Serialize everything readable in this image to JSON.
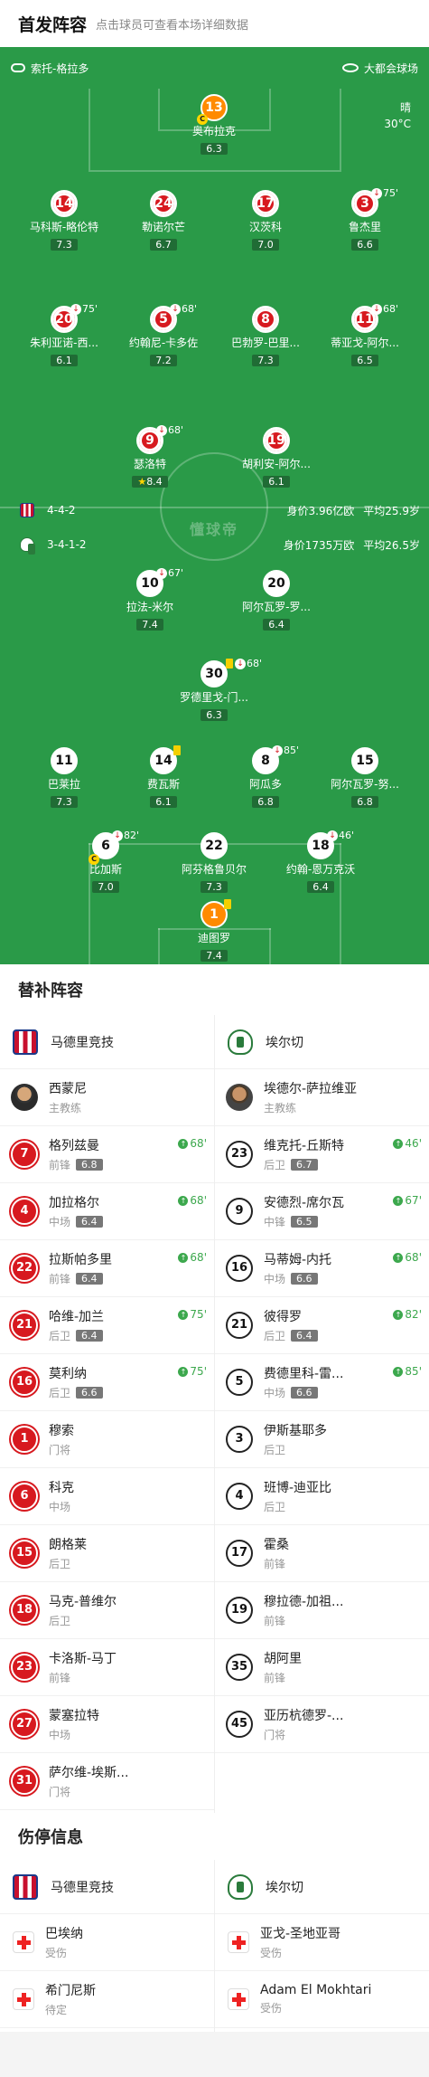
{
  "header": {
    "title": "首发阵容",
    "subtitle": "点击球员可查看本场详细数据"
  },
  "pitch": {
    "referee": "索托-格拉多",
    "stadium": "大都会球场",
    "weather": "晴",
    "temperature": "30°C",
    "watermark": "懂球帝",
    "home_form": {
      "formation": "4-4-2",
      "value": "身价3.96亿欧",
      "age": "平均25.9岁"
    },
    "away_form": {
      "formation": "3-4-1-2",
      "value": "身价1735万欧",
      "age": "平均26.5岁"
    }
  },
  "home_players": [
    {
      "num": "13",
      "name": "奥布拉克",
      "rating": "6.3"
    },
    {
      "num": "14",
      "name": "马科斯-略伦特",
      "rating": "7.3"
    },
    {
      "num": "24",
      "name": "勒诺尔芒",
      "rating": "6.7"
    },
    {
      "num": "17",
      "name": "汉茨科",
      "rating": "7.0"
    },
    {
      "num": "3",
      "name": "鲁杰里",
      "rating": "6.6",
      "sub": "75'"
    },
    {
      "num": "20",
      "name": "朱利亚诺-西...",
      "rating": "6.1",
      "sub": "75'"
    },
    {
      "num": "5",
      "name": "约翰尼-卡多佐",
      "rating": "7.2",
      "sub": "68'"
    },
    {
      "num": "8",
      "name": "巴勃罗-巴里...",
      "rating": "7.3"
    },
    {
      "num": "11",
      "name": "蒂亚戈-阿尔...",
      "rating": "6.5",
      "sub": "68'"
    },
    {
      "num": "9",
      "name": "瑟洛特",
      "rating": "8.4",
      "sub": "68'"
    },
    {
      "num": "19",
      "name": "胡利安-阿尔...",
      "rating": "6.1"
    }
  ],
  "away_players": [
    {
      "num": "10",
      "name": "拉法-米尔",
      "rating": "7.4",
      "sub": "67'"
    },
    {
      "num": "20",
      "name": "阿尔瓦罗-罗...",
      "rating": "6.4"
    },
    {
      "num": "30",
      "name": "罗德里戈-门...",
      "rating": "6.3",
      "sub": "68'"
    },
    {
      "num": "11",
      "name": "巴莱拉",
      "rating": "7.3"
    },
    {
      "num": "14",
      "name": "费瓦斯",
      "rating": "6.1"
    },
    {
      "num": "8",
      "name": "阿瓜多",
      "rating": "6.8",
      "sub": "85'"
    },
    {
      "num": "15",
      "name": "阿尔瓦罗-努...",
      "rating": "6.8"
    },
    {
      "num": "6",
      "name": "比加斯",
      "rating": "7.0",
      "sub": "82'"
    },
    {
      "num": "22",
      "name": "阿芬格鲁贝尔",
      "rating": "7.3"
    },
    {
      "num": "18",
      "name": "约翰-恩万克沃",
      "rating": "6.4",
      "sub": "46'"
    },
    {
      "num": "1",
      "name": "迪图罗",
      "rating": "7.4"
    }
  ],
  "subs": {
    "title": "替补阵容",
    "home_team": "马德里竞技",
    "away_team": "埃尔切",
    "home_coach": {
      "name": "西蒙尼",
      "role": "主教练"
    },
    "away_coach": {
      "name": "埃德尔-萨拉维亚",
      "role": "主教练"
    },
    "home": [
      {
        "num": "7",
        "name": "格列兹曼",
        "pos": "前锋",
        "rating": "6.8",
        "in": "68'"
      },
      {
        "num": "4",
        "name": "加拉格尔",
        "pos": "中场",
        "rating": "6.4",
        "in": "68'"
      },
      {
        "num": "22",
        "name": "拉斯帕多里",
        "pos": "前锋",
        "rating": "6.4",
        "in": "68'"
      },
      {
        "num": "21",
        "name": "哈维-加兰",
        "pos": "后卫",
        "rating": "6.4",
        "in": "75'"
      },
      {
        "num": "16",
        "name": "莫利纳",
        "pos": "后卫",
        "rating": "6.6",
        "in": "75'"
      },
      {
        "num": "1",
        "name": "穆索",
        "pos": "门将"
      },
      {
        "num": "6",
        "name": "科克",
        "pos": "中场"
      },
      {
        "num": "15",
        "name": "朗格莱",
        "pos": "后卫"
      },
      {
        "num": "18",
        "name": "马克-普维尔",
        "pos": "后卫"
      },
      {
        "num": "23",
        "name": "卡洛斯-马丁",
        "pos": "前锋"
      },
      {
        "num": "27",
        "name": "蒙塞拉特",
        "pos": "中场"
      },
      {
        "num": "31",
        "name": "萨尔维-埃斯...",
        "pos": "门将"
      }
    ],
    "away": [
      {
        "num": "23",
        "name": "维克托-丘斯特",
        "pos": "后卫",
        "rating": "6.7",
        "in": "46'"
      },
      {
        "num": "9",
        "name": "安德烈-席尔瓦",
        "pos": "中锋",
        "rating": "6.5",
        "in": "67'"
      },
      {
        "num": "16",
        "name": "马蒂姆-内托",
        "pos": "中场",
        "rating": "6.6",
        "in": "68'"
      },
      {
        "num": "21",
        "name": "彼得罗",
        "pos": "后卫",
        "rating": "6.4",
        "in": "82'"
      },
      {
        "num": "5",
        "name": "费德里科-雷...",
        "pos": "中场",
        "rating": "6.6",
        "in": "85'"
      },
      {
        "num": "3",
        "name": "伊斯基耶多",
        "pos": "后卫"
      },
      {
        "num": "4",
        "name": "班博-迪亚比",
        "pos": "后卫"
      },
      {
        "num": "17",
        "name": "霍桑",
        "pos": "前锋"
      },
      {
        "num": "19",
        "name": "穆拉德-加祖...",
        "pos": "前锋"
      },
      {
        "num": "35",
        "name": "胡阿里",
        "pos": "前锋"
      },
      {
        "num": "45",
        "name": "亚历杭德罗-...",
        "pos": "门将"
      }
    ]
  },
  "injuries": {
    "title": "伤停信息",
    "home": [
      {
        "name": "巴埃纳",
        "status": "受伤"
      },
      {
        "name": "希门尼斯",
        "status": "待定"
      }
    ],
    "away": [
      {
        "name": "亚戈-圣地亚哥",
        "status": "受伤"
      },
      {
        "name": "Adam El Mokhtari",
        "status": "受伤"
      }
    ]
  },
  "colors": {
    "pitch": "#2a9a48",
    "home": "#d7191f",
    "away": "#ffffff",
    "keeper": "#ff8a00",
    "sub_in": "#3ca84d"
  }
}
